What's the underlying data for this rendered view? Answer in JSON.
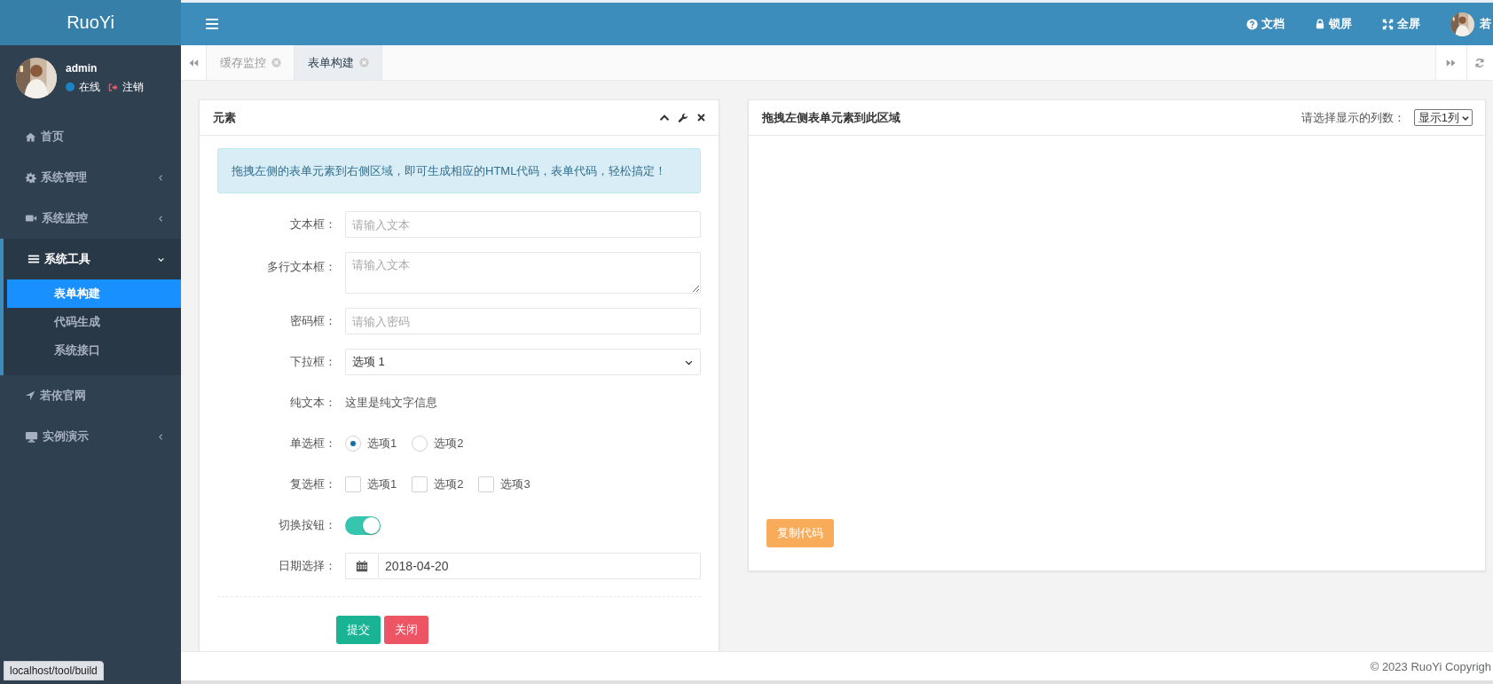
{
  "sidebar": {
    "logo": "RuoYi",
    "user": {
      "name": "admin",
      "status": "在线",
      "logout": "注销"
    },
    "menu": [
      {
        "label": "首页",
        "kind": "link",
        "expanded": false
      },
      {
        "label": "系统管理",
        "kind": "menu",
        "expanded": false
      },
      {
        "label": "系统监控",
        "kind": "menu",
        "expanded": false
      },
      {
        "label": "系统工具",
        "kind": "menu",
        "expanded": true,
        "children": [
          {
            "label": "表单构建",
            "selected": true
          },
          {
            "label": "代码生成",
            "selected": false
          },
          {
            "label": "系统接口",
            "selected": false
          }
        ]
      },
      {
        "label": "若依官网",
        "kind": "link",
        "expanded": false
      },
      {
        "label": "实例演示",
        "kind": "menu",
        "expanded": false
      }
    ]
  },
  "topbar": {
    "actions": [
      {
        "label": "文档"
      },
      {
        "label": "锁屏"
      },
      {
        "label": "全屏"
      }
    ],
    "user": "若"
  },
  "tabs": [
    {
      "label": "缓存监控",
      "selected": false
    },
    {
      "label": "表单构建",
      "selected": true
    }
  ],
  "elements_panel": {
    "title": "元素",
    "alert": "拖拽左侧的表单元素到右侧区域，即可生成相应的HTML代码，表单代码，轻松搞定！",
    "fields": [
      {
        "kind": "text",
        "label": "文本框：",
        "placeholder": "请输入文本"
      },
      {
        "kind": "textarea",
        "label": "多行文本框：",
        "placeholder": "请输入文本"
      },
      {
        "kind": "password",
        "label": "密码框：",
        "placeholder": "请输入密码"
      },
      {
        "kind": "select",
        "label": "下拉框：",
        "value": "选项 1"
      },
      {
        "kind": "static",
        "label": "纯文本：",
        "value": "这里是纯文字信息"
      },
      {
        "kind": "radio",
        "label": "单选框：",
        "options": [
          {
            "label": "选项1",
            "selected": true
          },
          {
            "label": "选项2",
            "selected": false
          }
        ]
      },
      {
        "kind": "checkbox",
        "label": "复选框：",
        "options": [
          {
            "label": "选项1",
            "checked": false
          },
          {
            "label": "选项2",
            "checked": false
          },
          {
            "label": "选项3",
            "checked": false
          }
        ]
      },
      {
        "kind": "switch",
        "label": "切换按钮：",
        "on": true
      },
      {
        "kind": "date",
        "label": "日期选择：",
        "value": "2018-04-20"
      }
    ],
    "buttons": [
      {
        "label": "提交",
        "kind": "primary"
      },
      {
        "label": "关闭",
        "kind": "danger"
      }
    ]
  },
  "preview_panel": {
    "title": "拖拽左侧表单元素到此区域",
    "columns_label": "请选择显示的列数：",
    "columns_value": "显示1列",
    "copy_button": "复制代码"
  },
  "footer": "© 2023 RuoYi Copyrigh",
  "status_url": "localhost/tool/build"
}
